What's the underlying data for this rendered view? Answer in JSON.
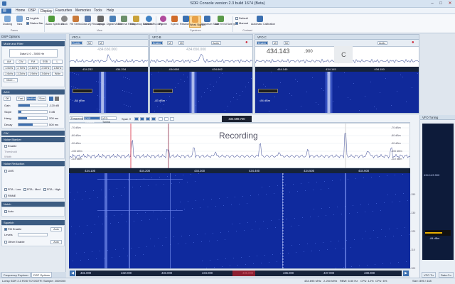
{
  "window": {
    "title": "SDR Console version 2.3 build 1674 (Beta)",
    "minimize": "–",
    "maximize": "□",
    "close": "✕"
  },
  "menu": [
    "Home",
    "DSP",
    "Display",
    "Favourites",
    "Memories",
    "Tools",
    "Help"
  ],
  "menu_active": 2,
  "ribbon": {
    "buttons": [
      {
        "label": "Docking",
        "icon_color": "#7aa6d6"
      },
      {
        "label": "Tabs",
        "icon_color": "#7aa6d6"
      },
      {
        "label": "Audio Spectrum",
        "icon_color": "#4f9a3c"
      },
      {
        "label": "Clock",
        "icon_color": "#888888"
      },
      {
        "label": "FM Stereo",
        "icon_color": "#c9793a"
      },
      {
        "label": "Data I/Q Recordings",
        "icon_color": "#5577aa"
      },
      {
        "label": "Layout",
        "icon_color": "#666666"
      },
      {
        "label": "Digital Modes",
        "icon_color": "#4a7fb7"
      },
      {
        "label": "External Radio",
        "icon_color": "#6a8f6a"
      },
      {
        "label": "Frequency Database",
        "icon_color": "#c9a23a"
      },
      {
        "label": "Satellite Tracking",
        "icon_color": "#3f82c5"
      },
      {
        "label": "Palette",
        "icon_color": "#b04a9c"
      },
      {
        "label": "Speed",
        "icon_color": "#d06b2a"
      },
      {
        "label": "Resolution",
        "icon_color": "#3a6fb0"
      },
      {
        "label": "Weak Signals",
        "icon_color": "#e8a24a"
      },
      {
        "label": "Spectrum Scale",
        "icon_color": "#3a6fb0"
      },
      {
        "label": "Add Trend Sweeps",
        "icon_color": "#5a9a4a"
      },
      {
        "label": "Automatic Calibration",
        "icon_color": "#3a6fb0"
      }
    ],
    "checkboxes": [
      {
        "label": "Legible",
        "on": false
      },
      {
        "label": "Status Bar",
        "on": true
      }
    ],
    "contrast_options": [
      {
        "label": "Default",
        "on": false
      },
      {
        "label": "Manual",
        "on": true
      }
    ],
    "groups": [
      "Panes",
      "View",
      "Spectrum",
      "Contrast"
    ]
  },
  "left_panel": {
    "title": "DSP Options",
    "tab_dsp": "DSP Options",
    "tab_freq": "Frequency Explorer",
    "sections": {
      "mode": "Mode and Filter",
      "agc": "AGC",
      "cw": "CW",
      "noise_blanker": "Noise Blanker",
      "noise_reduction": "Noise Reduction",
      "notch": "Notch",
      "squelch": "Squelch"
    },
    "filter_display": "Data U  0 - 3000 Hz",
    "mode_buttons": [
      "AM",
      "CW",
      "FM",
      "SSB",
      "L"
    ],
    "filters": [
      "3.0kHz",
      "2.7kHz",
      "2.4kHz",
      "2.0kHz",
      "1.8kHz",
      "2.6kHz",
      "3.2kHz",
      "1.9kHz",
      "3.6kHz",
      "Wide",
      "More..."
    ],
    "agc_buttons": [
      "Off",
      "Fast",
      "Medium",
      "Slow"
    ],
    "agc_rows": [
      {
        "label": "Gain",
        "value": "-120 dB",
        "fill": 0.4
      },
      {
        "label": "Slope",
        "value": "0 dB",
        "fill": 0.1
      },
      {
        "label": "Hang",
        "value": "200 ms",
        "fill": 0.3
      },
      {
        "label": "Decay",
        "value": "500 ms",
        "fill": 0.5
      }
    ],
    "nb_enable": "Enable",
    "nb_threshold": "Threshold",
    "nb_width": "Width",
    "nr_options": [
      "LMS",
      "RTA - Low",
      "RTA - Med",
      "RTA - High",
      "RNNE"
    ],
    "notch_auto": "Auto",
    "squelch_fm": "FM Enable",
    "squelch_level": "Levels",
    "squelch_auto": "Auto",
    "squelch_other": "Other Enable"
  },
  "vfos": [
    {
      "title": "VFO A",
      "freq": "434.650.000",
      "dbm": "-84 dBm",
      "axis": [
        "434.232",
        "434.234"
      ]
    },
    {
      "title": "VFO B",
      "freq": "434.650.000",
      "dbm": "-83 dBm",
      "axis": [
        "434.660",
        "434.662"
      ]
    },
    {
      "title": "VFO C",
      "freq": "434.143",
      "freq_small": ".900",
      "dbm": "-84 dBm",
      "axis": [
        "434.140",
        "434.145",
        "434.150"
      ]
    }
  ],
  "vfo_controls": {
    "enable": "Enable",
    "audio": "Audio",
    "a1": "MI",
    "a2": "MI"
  },
  "main": {
    "tabs": [
      "Frequency",
      "DSP Options",
      "VFO Tuning"
    ],
    "span_label": "Span",
    "center_freq": "434.598.700",
    "recording": "Recording",
    "db_labels": [
      "-70 dBm",
      "-80 dBm",
      "-90 dBm",
      "-100 dBm",
      "-110 dBm"
    ],
    "db_labels_right": [
      "-70 dBm",
      "-80 dBm",
      "-90 dBm",
      "-100 dBm",
      "-110 dBm"
    ],
    "freq_axis": [
      "434.100",
      "434.200",
      "434.300",
      "434.400",
      "434.500",
      "434.600",
      "434.700"
    ],
    "wf_levels_right": [
      "-150",
      "-130",
      "-120",
      "-110",
      "-100"
    ],
    "bottom_axis": [
      "431.000",
      "432.000",
      "433.000",
      "434.000",
      "435.000",
      "436.000",
      "437.000",
      "438.000"
    ]
  },
  "right_panel": {
    "title": "VFO Tuning",
    "freq": "434.143.900",
    "level": "-84 dBm",
    "tab1": "VFO Tu",
    "tab2": "Data Co"
  },
  "status": {
    "left": "Lcrisp SDR 2.3 RX8 TCVXDTR: Sample: 2000000",
    "freq": "434.695 MHz",
    "rate": "2.250 MHz",
    "rbw": "RBW: 6.50 Hz",
    "cpu": "CPU: 12%",
    "vfo": "CPU: 6%",
    "size": "Size: 895 / 448"
  }
}
